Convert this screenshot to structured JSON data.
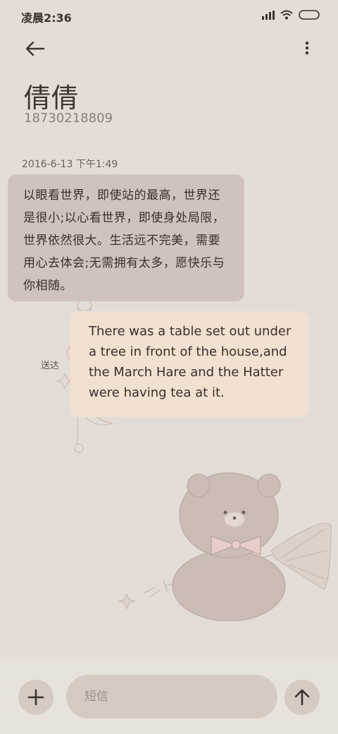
{
  "status_bar": {
    "time": "凌晨2:36",
    "icons": [
      "signal-icon",
      "wifi-icon",
      "battery-icon"
    ]
  },
  "header": {
    "back_icon": "arrow-left-icon",
    "more_icon": "more-vertical-icon"
  },
  "contact": {
    "name": "倩倩",
    "number": "18730218809"
  },
  "conversation": {
    "timestamp": "2016-6-13 下午1:49",
    "messages": [
      {
        "direction": "incoming",
        "text": "以眼看世界，即使站的最高，世界还是很小;以心看世界，即使身处局限，世界依然很大。生活远不完美，需要用心去体会;无需拥有太多，愿快乐与你相随。"
      },
      {
        "direction": "outgoing",
        "text": "There was a table set out under a tree in front of the house,and the March Hare and the Hatter were having tea at it.",
        "status": "送达"
      }
    ]
  },
  "composer": {
    "add_icon": "plus-icon",
    "placeholder": "短信",
    "value": "",
    "send_icon": "arrow-up-icon"
  },
  "colors": {
    "background": "#e4ddd7",
    "incoming_bubble": "#d0c2bd",
    "outgoing_bubble": "#f2e1d1",
    "button_bg": "#d6cbc3",
    "text": "#3a302c"
  }
}
